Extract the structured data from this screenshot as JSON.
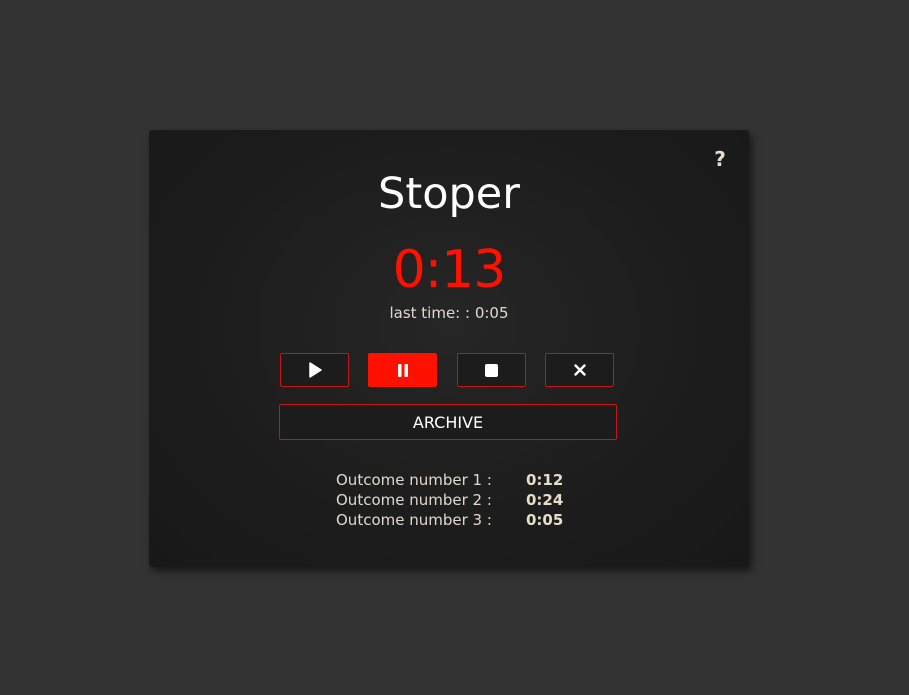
{
  "app": {
    "title": "Stoper",
    "help_label": "?"
  },
  "timer": {
    "current": "0:13",
    "current_color": "#ff1100",
    "last_time_text": "last time: : 0:05"
  },
  "controls": {
    "play_icon": "play-icon",
    "pause_icon": "pause-icon",
    "stop_icon": "stop-icon",
    "reset_icon": "close-icon",
    "active_button": "pause",
    "accent_color": "#ff1100"
  },
  "archive": {
    "label": "ARCHIVE"
  },
  "outcomes": [
    {
      "label": "Outcome number 1 :",
      "value": "0:12"
    },
    {
      "label": "Outcome number 2 :",
      "value": "0:24"
    },
    {
      "label": "Outcome number 3 :",
      "value": "0:05"
    }
  ]
}
